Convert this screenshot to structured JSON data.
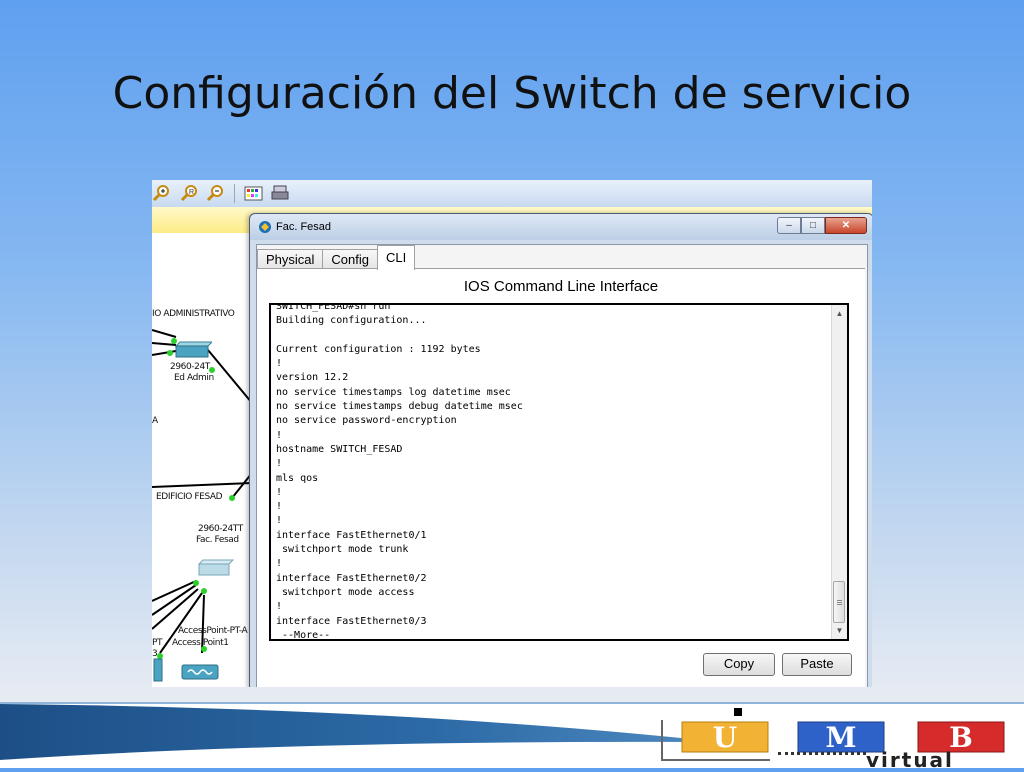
{
  "slide": {
    "title": "Configuración del Switch de servicio"
  },
  "topology": {
    "labels": {
      "building_admin": "IO ADMINISTRATIVO",
      "switch_admin_model": "2960-24T",
      "switch_admin_name": "Ed Admin",
      "cut_letter": "A",
      "building_fesad": "EDIFICIO FESAD",
      "switch_fesad_model": "2960-24TT",
      "switch_fesad_name": "Fac. Fesad",
      "ap_model": "AccessPoint-PT-A",
      "ap_name": "Access Point1",
      "cut_pt": "PT",
      "cut_3": "3"
    }
  },
  "window": {
    "title": "Fac. Fesad",
    "buttons": {
      "minimize": "–",
      "maximize": "□",
      "close": "✕"
    },
    "tabs": [
      {
        "label": "Physical",
        "active": false
      },
      {
        "label": "Config",
        "active": false
      },
      {
        "label": "CLI",
        "active": true
      }
    ],
    "cli": {
      "heading": "IOS Command Line Interface",
      "lines": [
        "SWITCH_FESAD#sh run",
        "Building configuration...",
        "",
        "Current configuration : 1192 bytes",
        "!",
        "version 12.2",
        "no service timestamps log datetime msec",
        "no service timestamps debug datetime msec",
        "no service password-encryption",
        "!",
        "hostname SWITCH_FESAD",
        "!",
        "mls qos",
        "!",
        "!",
        "!",
        "interface FastEthernet0/1",
        " switchport mode trunk",
        "!",
        "interface FastEthernet0/2",
        " switchport mode access",
        "!",
        "interface FastEthernet0/3",
        " --More--"
      ]
    },
    "copy_label": "Copy",
    "paste_label": "Paste"
  },
  "footer": {
    "logo_letters": [
      "U",
      "M",
      "B"
    ],
    "logo_text": "virtual",
    "colors": {
      "u": "#f2b233",
      "m": "#2f62c8",
      "b": "#d62b2b"
    }
  }
}
